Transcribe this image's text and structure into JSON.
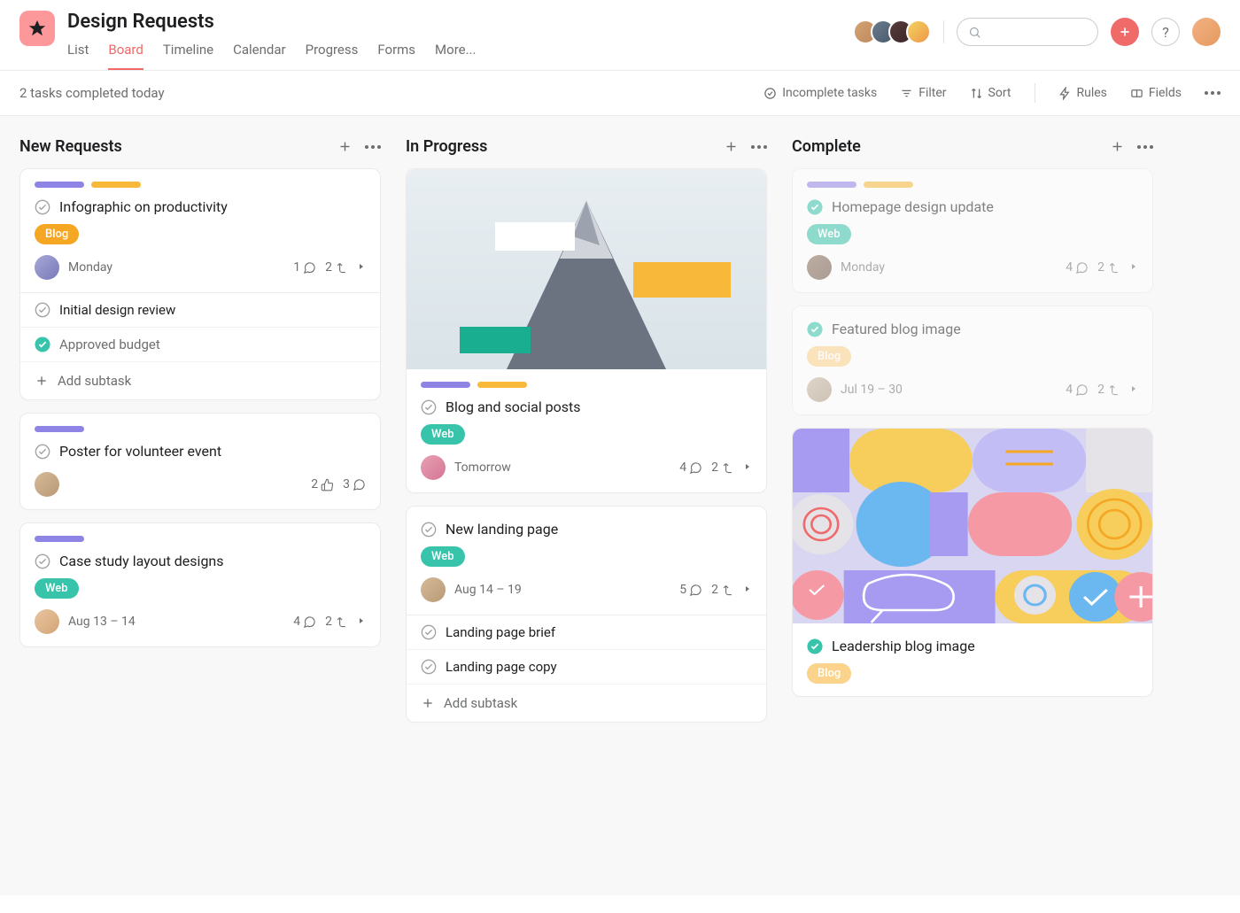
{
  "header": {
    "title": "Design Requests",
    "tabs": [
      "List",
      "Board",
      "Timeline",
      "Calendar",
      "Progress",
      "Forms",
      "More..."
    ],
    "active_tab": "Board"
  },
  "toolbar": {
    "status_text": "2 tasks completed today",
    "incomplete": "Incomplete tasks",
    "filter": "Filter",
    "sort": "Sort",
    "rules": "Rules",
    "fields": "Fields"
  },
  "columns": {
    "new_requests": {
      "title": "New Requests",
      "cards": [
        {
          "title": "Infographic on productivity",
          "tag": "Blog",
          "date": "Monday",
          "comments": "1",
          "subtasks_count": "2",
          "subtasks": [
            {
              "title": "Initial design review",
              "done": false
            },
            {
              "title": "Approved budget",
              "done": true
            }
          ],
          "add_subtask": "Add subtask"
        },
        {
          "title": "Poster for volunteer event",
          "likes": "2",
          "comments": "3"
        },
        {
          "title": "Case study layout designs",
          "tag": "Web",
          "date": "Aug 13 – 14",
          "comments": "4",
          "subtasks_count": "2"
        }
      ]
    },
    "in_progress": {
      "title": "In Progress",
      "cards": [
        {
          "title": "Blog and social posts",
          "tag": "Web",
          "date": "Tomorrow",
          "comments": "4",
          "subtasks_count": "2"
        },
        {
          "title": "New landing page",
          "tag": "Web",
          "date": "Aug 14 – 19",
          "comments": "5",
          "subtasks_count": "2",
          "subtasks": [
            {
              "title": "Landing page brief",
              "done": false
            },
            {
              "title": "Landing page copy",
              "done": false
            }
          ],
          "add_subtask": "Add subtask"
        }
      ]
    },
    "complete": {
      "title": "Complete",
      "cards": [
        {
          "title": "Homepage design update",
          "tag": "Web",
          "date": "Monday",
          "comments": "4",
          "subtasks_count": "2"
        },
        {
          "title": "Featured blog image",
          "tag": "Blog",
          "date": "Jul 19 – 30",
          "comments": "4",
          "subtasks_count": "2"
        },
        {
          "title": "Leadership blog image",
          "tag": "Blog"
        }
      ]
    }
  }
}
